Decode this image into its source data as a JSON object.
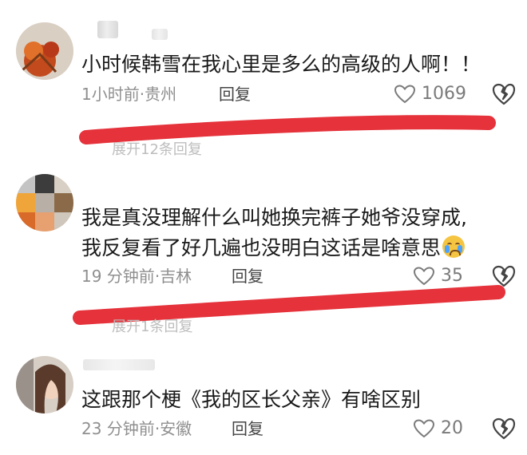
{
  "comments": [
    {
      "text_lines": [
        "小时候韩雪在我心里是多么的高级的人啊！！"
      ],
      "time": "1小时前",
      "location": "贵州",
      "reply_label": "回复",
      "likes": "1069",
      "expand_label": "展开12条回复",
      "avatar": "autumn-leaves-avatar",
      "like_icon": "heart-outline-icon",
      "dislike_icon": "broken-heart-icon"
    },
    {
      "text_lines": [
        "我是真没理解什么叫她换完裤子她爷没穿成,",
        "我反复看了好几遍也没明白这话是啥意思"
      ],
      "emoji": "crying-face-emoji",
      "time": "19 分钟前",
      "location": "吉林",
      "reply_label": "回复",
      "likes": "35",
      "expand_label": "展开1条回复",
      "avatar": "mosaic-avatar",
      "like_icon": "heart-outline-icon",
      "dislike_icon": "broken-heart-icon"
    },
    {
      "text_lines": [
        "这跟那个梗《我的区长父亲》有啥区别"
      ],
      "time": "23 分钟前",
      "location": "安徽",
      "reply_label": "回复",
      "likes": "20",
      "avatar": "woman-portrait-avatar",
      "like_icon": "heart-outline-icon",
      "dislike_icon": "broken-heart-icon"
    }
  ],
  "separator": "·",
  "colors": {
    "red_annotation": "#e5323b",
    "text": "#1a1a1a",
    "meta": "#8f8f8f"
  }
}
